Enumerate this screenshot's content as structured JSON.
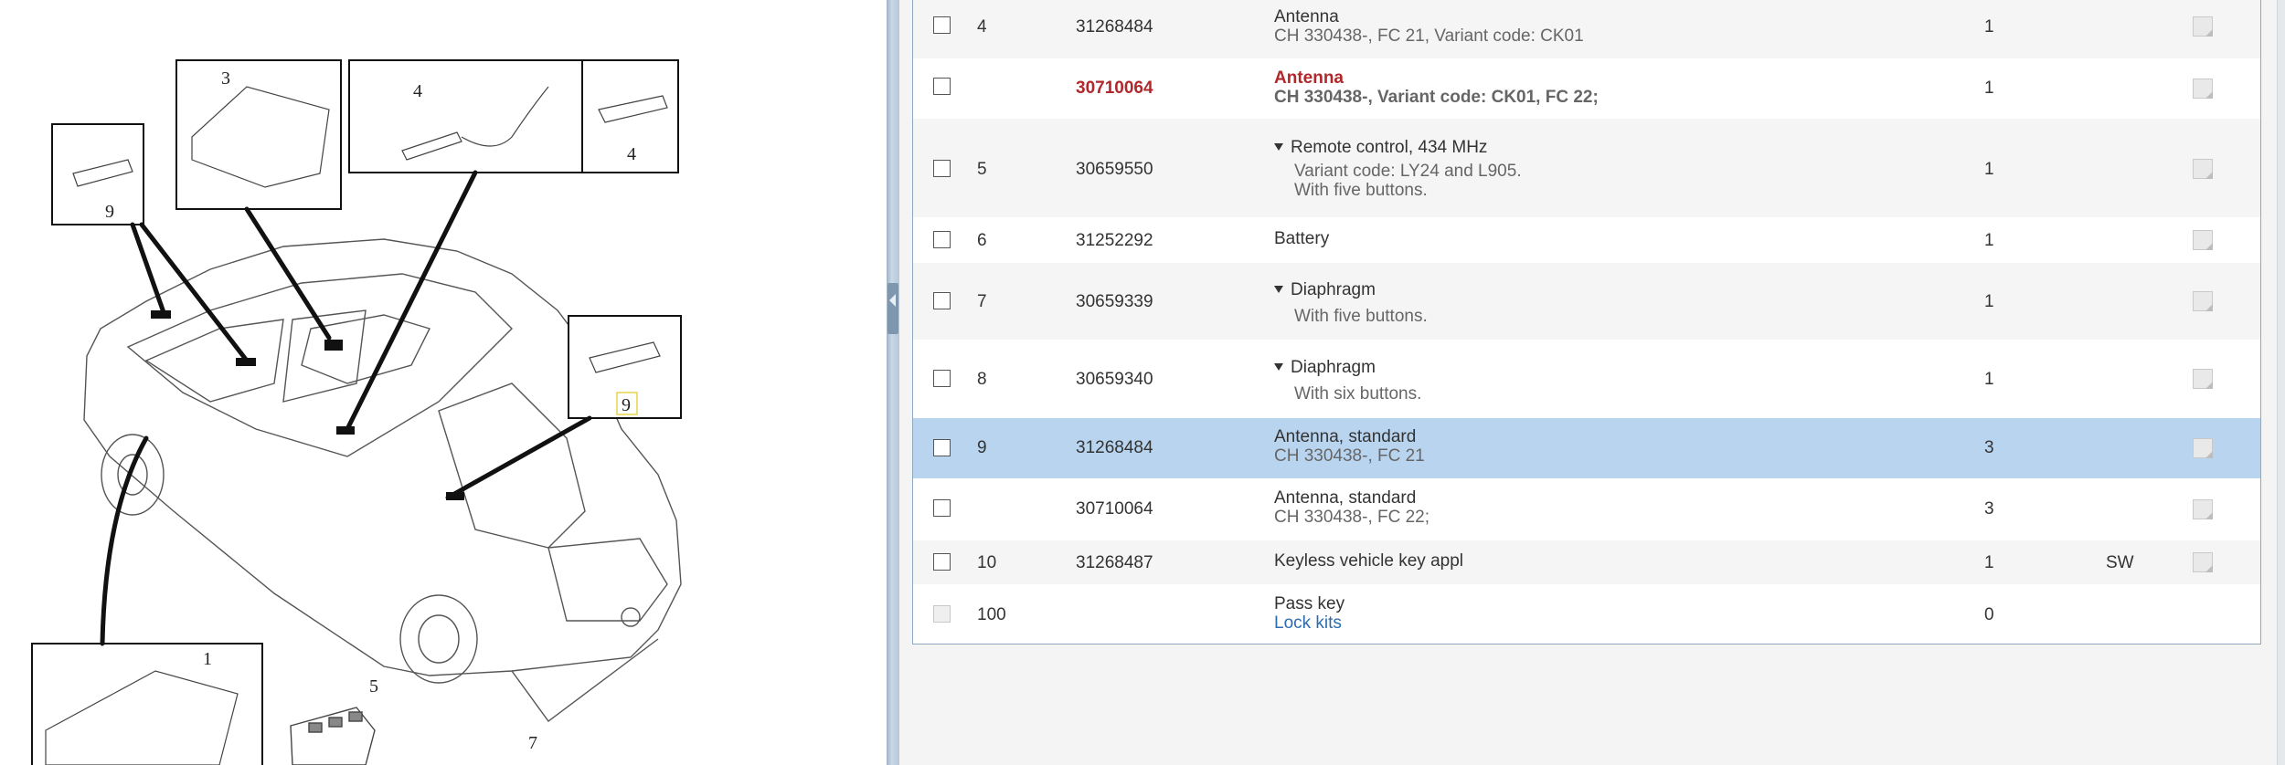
{
  "diagram": {
    "callouts": [
      "3",
      "4",
      "4",
      "9",
      "9",
      "1",
      "5",
      "7"
    ]
  },
  "parts": {
    "rows": [
      {
        "pos": "4",
        "part": "31268484",
        "title": "Antenna",
        "lines": [
          "CH 330438-, FC 21, Variant code: CK01"
        ],
        "qty": "1",
        "code": ""
      },
      {
        "pos": "",
        "part": "30710064",
        "title": "Antenna",
        "lines": [
          "CH 330438-, Variant code: CK01, FC 22;"
        ],
        "qty": "1",
        "code": ""
      },
      {
        "pos": "5",
        "part": "30659550",
        "title": "Remote control, 434 MHz",
        "lines": [
          "Variant code: LY24 and L905.",
          "With five buttons."
        ],
        "qty": "1",
        "code": ""
      },
      {
        "pos": "6",
        "part": "31252292",
        "title": "Battery",
        "lines": [],
        "qty": "1",
        "code": ""
      },
      {
        "pos": "7",
        "part": "30659339",
        "title": "Diaphragm",
        "lines": [
          "With five buttons."
        ],
        "qty": "1",
        "code": ""
      },
      {
        "pos": "8",
        "part": "30659340",
        "title": "Diaphragm",
        "lines": [
          "With six buttons."
        ],
        "qty": "1",
        "code": ""
      },
      {
        "pos": "9",
        "part": "31268484",
        "title": "Antenna, standard",
        "lines": [
          "CH 330438-, FC 21"
        ],
        "qty": "3",
        "code": ""
      },
      {
        "pos": "",
        "part": "30710064",
        "title": "Antenna, standard",
        "lines": [
          "CH 330438-, FC 22;"
        ],
        "qty": "3",
        "code": ""
      },
      {
        "pos": "10",
        "part": "31268487",
        "title": "Keyless vehicle key appl",
        "lines": [],
        "qty": "1",
        "code": "SW"
      },
      {
        "pos": "100",
        "part": "",
        "title": "Pass key",
        "link": "Lock kits",
        "lines": [],
        "qty": "0",
        "code": ""
      }
    ]
  },
  "colors": {
    "selected_row": "#b8d4ef",
    "highlight_red": "#b0282b",
    "link_blue": "#2e6cb0"
  }
}
